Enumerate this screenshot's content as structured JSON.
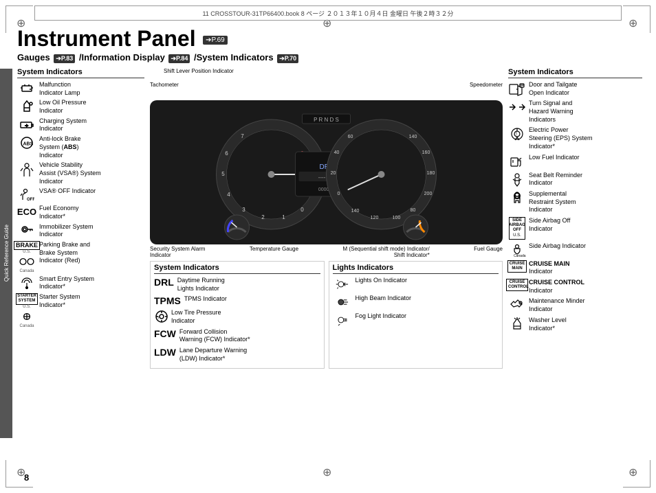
{
  "page": {
    "number": "8",
    "top_bar_text": "11 CROSSTOUR-31TP66400.book  8 ページ  ２０１３年１０月４日  金曜日  午後２時３２分",
    "side_label": "Quick Reference Guide"
  },
  "title": {
    "main": "Instrument Panel",
    "ref": "➔P.69",
    "subtitle_gauges": "Gauges",
    "subtitle_gauges_ref": "➔P.83",
    "subtitle_info": "/Information Display",
    "subtitle_info_ref": "➔P.84",
    "subtitle_sys": "/System Indicators",
    "subtitle_sys_ref": "➔P.70"
  },
  "left_column": {
    "section_title": "System Indicators",
    "items": [
      {
        "icon": "engine",
        "text": "Malfunction Indicator Lamp"
      },
      {
        "icon": "oil",
        "text": "Low Oil Pressure Indicator"
      },
      {
        "icon": "battery",
        "text": "Charging System Indicator"
      },
      {
        "icon": "abs",
        "text": "Anti-lock Brake System (ABS) Indicator"
      },
      {
        "icon": "vsa_person",
        "text": "Vehicle Stability Assist (VSA®) System Indicator"
      },
      {
        "icon": "vsa_off",
        "text": "VSA® OFF Indicator"
      },
      {
        "icon": "eco",
        "text": "Fuel Economy Indicator*"
      },
      {
        "icon": "key",
        "text": "Immobilizer System Indicator"
      },
      {
        "icon": "brake_red",
        "text": "Parking Brake and Brake System Indicator (Red)"
      },
      {
        "icon": "smart_entry",
        "text": "Smart Entry System Indicator*"
      },
      {
        "icon": "starter_system",
        "text": "Starter System Indicator*"
      }
    ]
  },
  "center": {
    "gauge_labels": {
      "tachometer": "Tachometer",
      "speedometer": "Speedometer",
      "shift_lever": "Shift Lever Position Indicator",
      "security": "Security System Alarm Indicator",
      "temperature": "Temperature Gauge",
      "fuel": "Fuel Gauge",
      "sequential": "M (Sequential shift mode) Indicator/ Shift Indicator*"
    },
    "bottom_section": {
      "system_indicators_title": "System Indicators",
      "lights_indicators_title": "Lights Indicators",
      "system_items": [
        {
          "badge": "DRL",
          "text": "Daytime Running Lights Indicator"
        },
        {
          "badge": "TPMS",
          "text": "TPMS Indicator"
        },
        {
          "icon": "tire",
          "text": "Low Tire Pressure Indicator"
        },
        {
          "badge": "FCW",
          "text": "Forward Collision Warning (FCW) Indicator*"
        },
        {
          "badge": "LDW",
          "text": "Lane Departure Warning (LDW) Indicator*"
        }
      ],
      "lights_items": [
        {
          "icon": "lights_on",
          "text": "Lights On Indicator"
        },
        {
          "icon": "high_beam",
          "text": "High Beam Indicator"
        },
        {
          "icon": "fog",
          "text": "Fog Light Indicator"
        }
      ]
    }
  },
  "right_column": {
    "section_title": "System Indicators",
    "items": [
      {
        "icon": "door",
        "text": "Door and Tailgate Open Indicator"
      },
      {
        "icon": "turn_signal",
        "text": "Turn Signal and Hazard Warning Indicators"
      },
      {
        "icon": "eps",
        "text": "Electric Power Steering (EPS) System Indicator*"
      },
      {
        "icon": "fuel_low",
        "text": "Low Fuel Indicator"
      },
      {
        "icon": "seatbelt",
        "text": "Seat Belt Reminder Indicator"
      },
      {
        "icon": "srs",
        "text": "Supplemental Restraint System Indicator"
      },
      {
        "icon": "side_airbag_off",
        "text": "Side Airbag Off Indicator"
      },
      {
        "icon": "cruise_main",
        "badge": "CRUISE MAIN",
        "text": "Indicator"
      },
      {
        "icon": "cruise_control",
        "badge": "CRUISE CONTROL",
        "text": "Indicator"
      },
      {
        "icon": "maintenance",
        "text": "Maintenance Minder Indicator"
      },
      {
        "icon": "washer",
        "text": "Washer Level Indicator*"
      }
    ]
  }
}
